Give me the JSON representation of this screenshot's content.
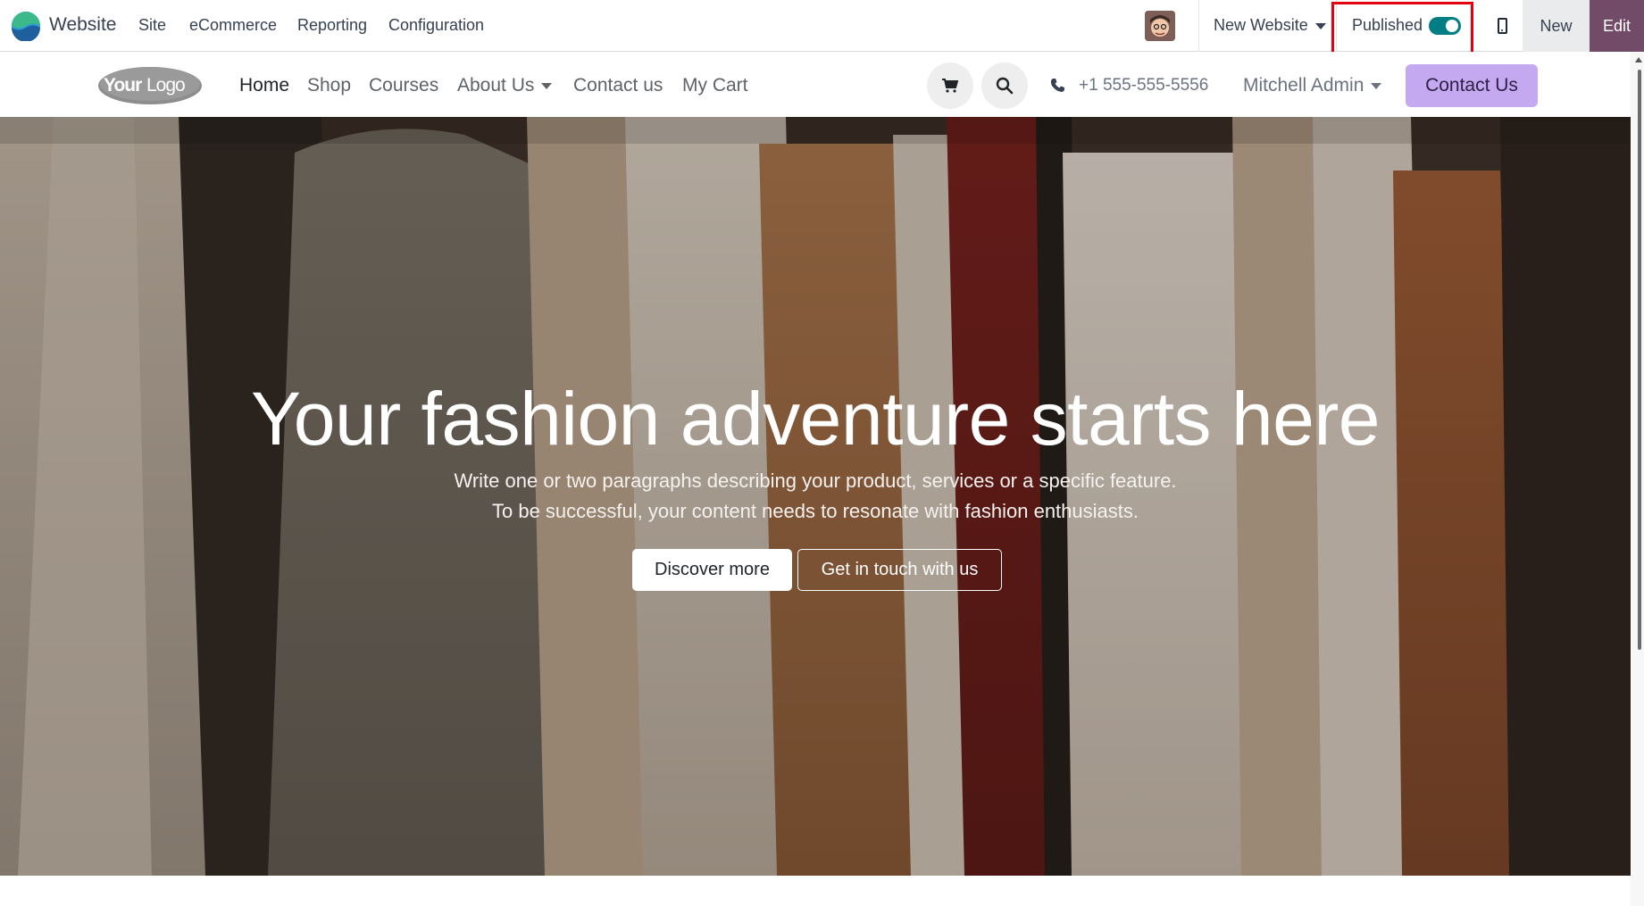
{
  "topbar": {
    "app_name": "Website",
    "menus": [
      "Site",
      "eCommerce",
      "Reporting",
      "Configuration"
    ],
    "website_selector": "New Website",
    "published_label": "Published",
    "published": true,
    "new_label": "New",
    "edit_label": "Edit"
  },
  "site": {
    "logo_text": "YourLogo",
    "nav": [
      "Home",
      "Shop",
      "Courses",
      "About Us",
      "Contact us",
      "My Cart"
    ],
    "active_nav": "Home",
    "phone": "+1 555-555-5556",
    "user": "Mitchell Admin",
    "contact_button": "Contact Us"
  },
  "hero": {
    "title": "Your fashion adventure starts here",
    "line1": "Write one or two paragraphs describing your product, services or a specific feature.",
    "line2": "To be successful, your content needs to resonate with fashion enthusiasts.",
    "primary_button": "Discover more",
    "secondary_button": "Get in touch with us"
  },
  "colors": {
    "odoo_purple": "#714b67",
    "toggle_on": "#017e84",
    "contact_button_bg": "#c4a9f0",
    "highlight_box": "#e3000f"
  }
}
